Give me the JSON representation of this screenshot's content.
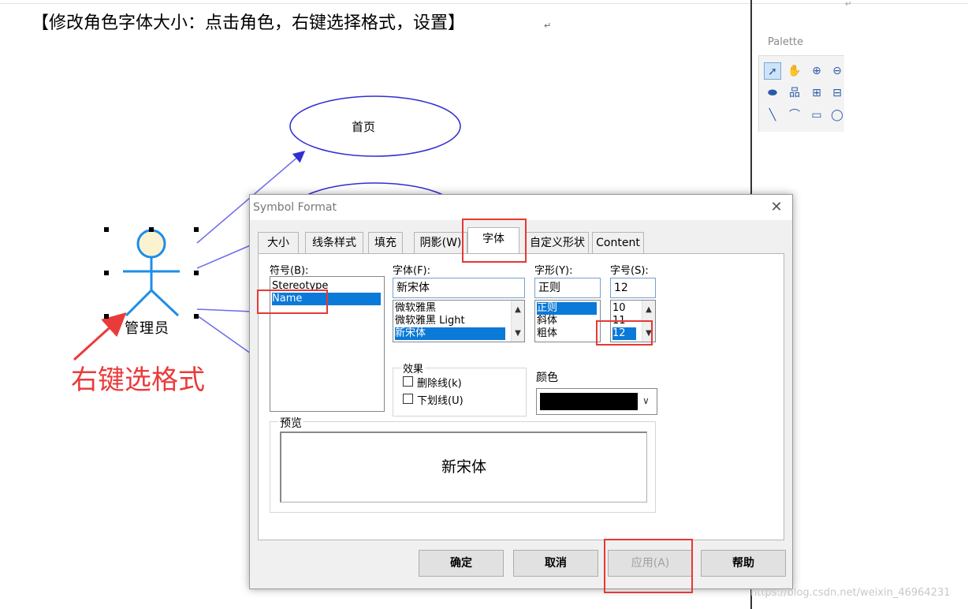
{
  "heading": "【修改角色字体大小：点击角色，右键选择格式，设置】",
  "palette": {
    "title": "Palette",
    "tools": [
      "pointer-icon",
      "hand-icon",
      "zoom-in-icon",
      "zoom-out-icon",
      "ellipse-icon",
      "hierarchy-icon",
      "package-icon",
      "class-icon",
      "line-icon",
      "arc-icon",
      "rectangle-icon",
      "oval-icon"
    ]
  },
  "diagram": {
    "usecase1": "首页",
    "actor": "管理员",
    "annotation": "右键选格式",
    "line_color": "#6b6bf0",
    "ellipse_color": "#2f2fd1",
    "annotation_color": "#ea3b3b"
  },
  "dialog": {
    "title": "Symbol Format",
    "tabs": [
      "大小",
      "线条样式",
      "填充",
      "阴影(W)",
      "字体",
      "自定义形状",
      "Content"
    ],
    "active_tab": "字体",
    "symbol_label": "符号(B):",
    "symbol_items": [
      "Stereotype",
      "Name"
    ],
    "symbol_selected": "Name",
    "font_label": "字体(F):",
    "font_value": "新宋体",
    "font_items": [
      "微软雅黑",
      "微软雅黑 Light",
      "新宋体"
    ],
    "style_label": "字形(Y):",
    "style_value": "正则",
    "style_items": [
      "正则",
      "斜体",
      "粗体"
    ],
    "size_label": "字号(S):",
    "size_value": "12",
    "size_items": [
      "10",
      "11",
      "12"
    ],
    "effects_label": "效果",
    "strikeout_label": "删除线(k)",
    "underline_label": "下划线(U)",
    "color_label": "颜色",
    "color_value": "#000000",
    "preview_label": "预览",
    "preview_text": "新宋体",
    "buttons": {
      "ok": "确定",
      "cancel": "取消",
      "apply": "应用(A)",
      "help": "帮助"
    }
  },
  "watermark": "https://blog.csdn.net/weixin_46964231"
}
